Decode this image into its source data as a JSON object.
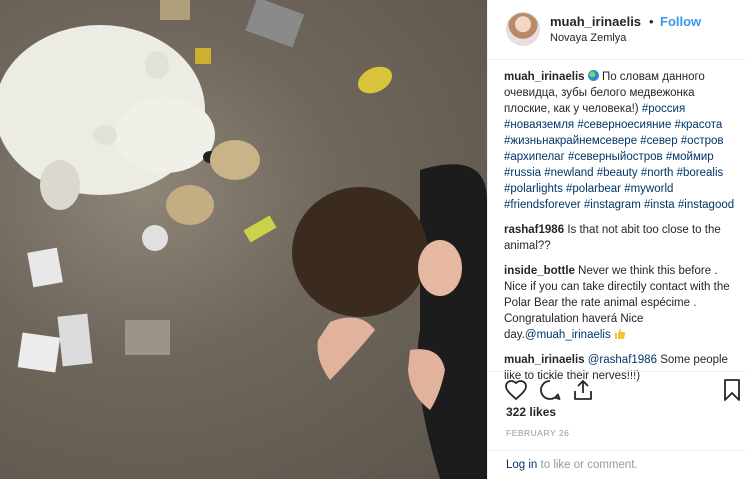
{
  "header": {
    "username": "muah_irinaelis",
    "separator": "•",
    "follow_label": "Follow",
    "location": "Novaya Zemlya"
  },
  "comments": [
    {
      "user": "muah_irinaelis",
      "text": "По словам данного очевидца, зубы белого медвежонка плоские, как у человека!)",
      "hashtags": "#россия #новаяземля #северноесияние #красота #жизньнакрайнемсевере #север #остров #архипелаг #северныйостров #моймир #russia #newland #beauty #north #borealis #polarlights #polarbear #myworld #friendsforever #instagram #insta #instagood"
    },
    {
      "user": "rashaf1986",
      "text": "Is that not abit too close to the animal??"
    },
    {
      "user": "inside_bottle",
      "text": "Never we think this before . Nice if you can take directily contact with the Polar Bear the rate animal espécime . Congratulation haverá Nice day.",
      "mention": "@muah_irinaelis"
    },
    {
      "user": "muah_irinaelis",
      "mention": "@rashaf1986",
      "text": "Some people like to tickle their nerves!!!)"
    }
  ],
  "footer": {
    "likes": "322 likes",
    "date": "FEBRUARY 26",
    "login_link": "Log in",
    "login_rest": " to like or comment."
  },
  "icons": [
    "heart-icon",
    "comment-icon",
    "share-icon",
    "bookmark-icon",
    "globe-emoji-icon",
    "thumbs-up-emoji-icon"
  ],
  "colors": {
    "link": "#3897f0",
    "hashtag": "#003569",
    "muted": "#999999",
    "text": "#262626"
  }
}
